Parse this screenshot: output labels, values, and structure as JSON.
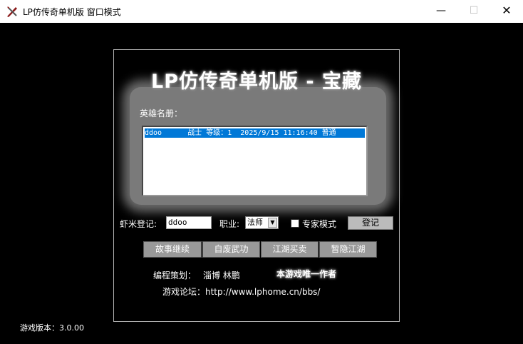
{
  "window": {
    "title": "LP仿传奇单机版 窗口模式",
    "minimize_glyph": "—",
    "maximize_glyph": "☐",
    "close_glyph": "✕",
    "icon": "sword-app-icon"
  },
  "game": {
    "title": "LP仿传奇单机版 - 宝藏",
    "roster_label": "英雄名册：",
    "roster": [
      {
        "text": "ddoo      战士 等级：1  2025/9/15 11:16:40 普通",
        "selected": true
      }
    ],
    "register": {
      "name_label": "虾米登记:",
      "name_value": "ddoo",
      "class_label": "职业:",
      "class_value": "法师",
      "expert_label": "专家模式",
      "expert_checked": false,
      "button": "登记"
    },
    "actions": [
      "故事继续",
      "自废武功",
      "江湖买卖",
      "暂隐江湖"
    ],
    "credits": {
      "label": "编程策划：",
      "authors": "淄博 林鹏",
      "tagline": "本游戏唯一作者"
    },
    "forum": "游戏论坛：http://www.lphome.cn/bbs/",
    "version": "游戏版本：3.0.00"
  },
  "colors": {
    "selection": "#0078d7",
    "background": "#000000",
    "panel_glow": "#7a7a7a"
  }
}
